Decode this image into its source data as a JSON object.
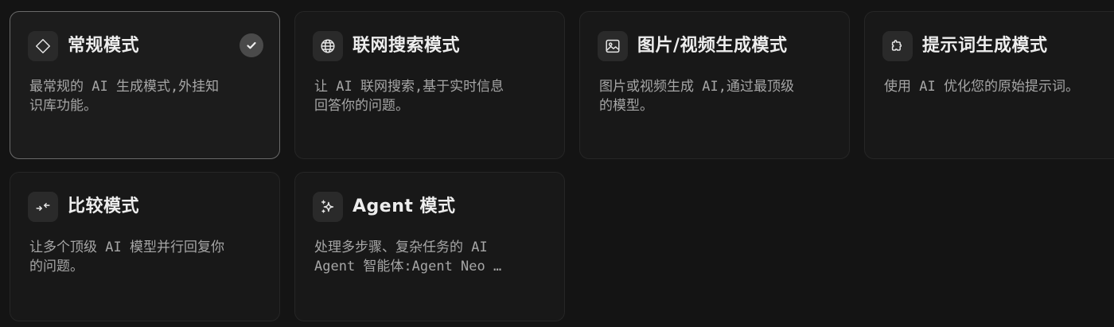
{
  "modes": [
    {
      "icon": "diamond-icon",
      "title": "常规模式",
      "description": "最常规的 AI 生成模式,外挂知\n识库功能。",
      "selected": true
    },
    {
      "icon": "globe-icon",
      "title": "联网搜索模式",
      "description": "让 AI 联网搜索,基于实时信息\n回答你的问题。",
      "selected": false
    },
    {
      "icon": "image-icon",
      "title": "图片/视频生成模式",
      "description": "图片或视频生成 AI,通过最顶级\n的模型。",
      "selected": false
    },
    {
      "icon": "puzzle-icon",
      "title": "提示词生成模式",
      "description": "使用 AI 优化您的原始提示词。",
      "selected": false
    },
    {
      "icon": "compare-arrows-icon",
      "title": "比较模式",
      "description": "让多个顶级 AI 模型并行回复你\n的问题。",
      "selected": false
    },
    {
      "icon": "sparkle-icon",
      "title": "Agent 模式",
      "description": "处理多步骤、复杂任务的 AI\nAgent 智能体:Agent Neo …",
      "selected": false
    }
  ],
  "selected_badge_icon": "checkmark-icon",
  "colors": {
    "background": "#141414",
    "card": "#181818",
    "card_border": "#262626",
    "selected_border": "#6a6a6a",
    "icon_box": "#2a2a2a",
    "title_text": "#ededed",
    "description_text": "#a6a6a6"
  }
}
